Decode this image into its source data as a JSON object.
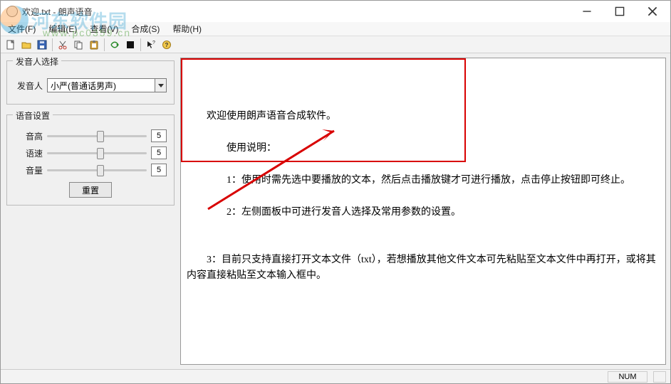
{
  "titlebar": {
    "title": "欢迎.txt - 朗声语音"
  },
  "menus": {
    "file": "文件(F)",
    "edit": "编辑(E)",
    "view": "查看(V)",
    "synth": "合成(S)",
    "help": "帮助(H)"
  },
  "watermark": {
    "text": "河东软件园",
    "url": "www.pc0359.cn"
  },
  "left": {
    "voice_group": "发音人选择",
    "voice_label": "发音人",
    "voice_value": "小严(普通话男声)",
    "settings_group": "语音设置",
    "pitch_label": "音高",
    "pitch_value": "5",
    "speed_label": "语速",
    "speed_value": "5",
    "volume_label": "音量",
    "volume_value": "5",
    "reset": "重置"
  },
  "text": {
    "l1": "欢迎使用朗声语音合成软件。",
    "l2": "使用说明：",
    "l3": "1：使用时需先选中要播放的文本，然后点击播放键才可进行播放，点击停止按钮即可终止。",
    "l4": "2：左侧面板中可进行发音人选择及常用参数的设置。",
    "l5": "3：目前只支持直接打开文本文件（txt），若想播放其他文件文本可先粘贴至文本文件中再打开，或将其内容直接粘贴至文本输入框中。"
  },
  "statusbar": {
    "num": "NUM"
  },
  "icons": {
    "new": "new-icon",
    "open": "open-icon",
    "save": "save-icon",
    "cut": "cut-icon",
    "copy": "copy-icon",
    "paste": "paste-icon",
    "play": "play-icon",
    "stop": "stop-icon",
    "help_pointer": "help-pointer-icon",
    "help": "help-icon"
  }
}
